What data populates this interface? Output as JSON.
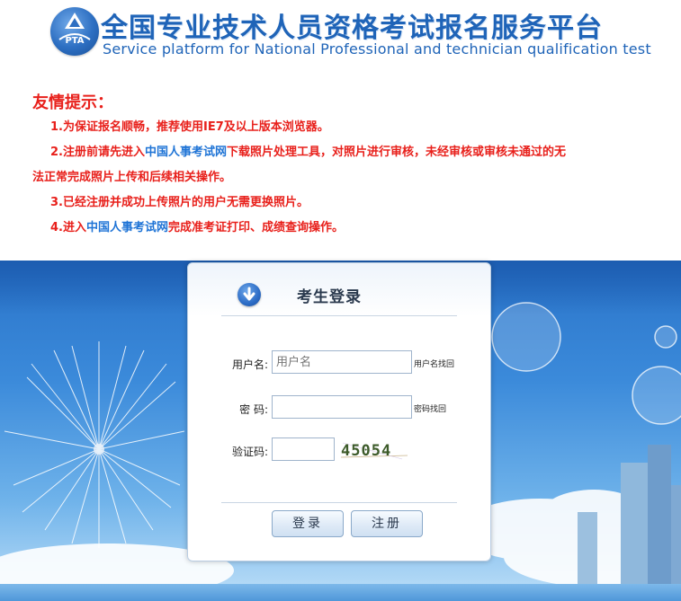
{
  "header": {
    "title": "全国专业技术人员资格考试报名服务平台",
    "subtitle": "Service platform for National Professional and technician qualification test",
    "logo_text": "PTA"
  },
  "notice": {
    "title": "友情提示：",
    "items": [
      {
        "parts": [
          "1.为保证报名顺畅，推荐使用IE7及以上版本浏览器。"
        ]
      },
      {
        "before": "2.注册前请先进入",
        "link": "中国人事考试网",
        "after": "下载照片处理工具，对照片进行审核，未经审核或审核未通过的无",
        "cont": "法正常完成照片上传和后续相关操作。"
      },
      {
        "parts": [
          "3.已经注册并成功上传照片的用户无需更换照片。"
        ]
      },
      {
        "before": "4.进入",
        "link": "中国人事考试网",
        "after": "完成准考证打印、成绩查询操作。"
      }
    ]
  },
  "login": {
    "title": "考生登录",
    "username_label": "用户名:",
    "username_placeholder": "用户名",
    "username_recover": "用户名找回",
    "password_label": "密 码:",
    "password_recover": "密码找回",
    "captcha_label": "验证码:",
    "captcha_text": "45054",
    "login_button": "登录",
    "register_button": "注册"
  },
  "colors": {
    "brand_blue": "#1f64b8",
    "notice_red": "#e8201b",
    "link_blue": "#1f74d6"
  }
}
